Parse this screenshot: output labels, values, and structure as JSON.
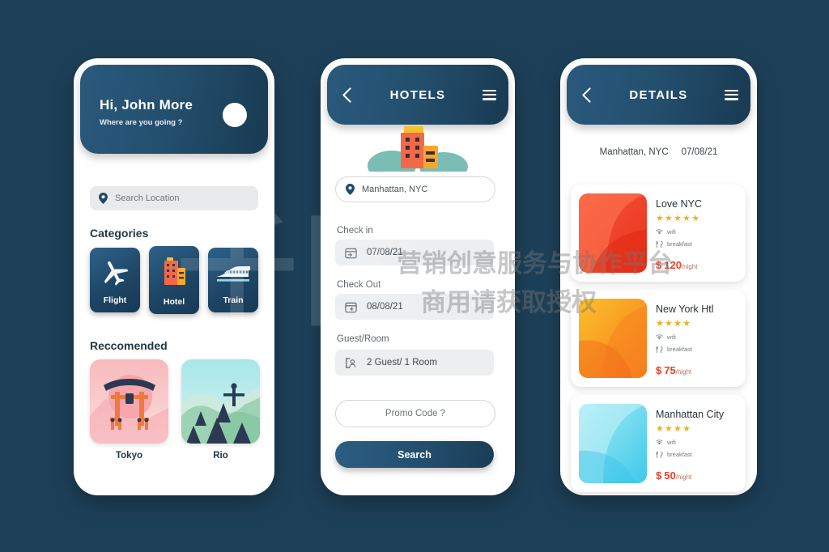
{
  "background_color": "#1d4059",
  "watermark": {
    "logo": "千图",
    "line1": "营销创意服务与协作平台",
    "line2": "商用请获取授权"
  },
  "home_screen": {
    "greeting": "Hi, John More",
    "subgreeting": "Where are you going ?",
    "avatar_icon": "avatar-circle-icon",
    "search": {
      "icon": "location-pin-icon",
      "placeholder": "Search Location"
    },
    "categories_title": "Categories",
    "categories": [
      {
        "label": "Flight",
        "icon": "airplane-icon"
      },
      {
        "label": "Hotel",
        "icon": "hotel-building-icon"
      },
      {
        "label": "Train",
        "icon": "train-icon"
      }
    ],
    "recommended_title": "Reccomended",
    "recommended": [
      {
        "label": "Tokyo",
        "icon": "torii-gate-illustration"
      },
      {
        "label": "Rio",
        "icon": "christ-redeemer-illustration"
      }
    ]
  },
  "hotels_screen": {
    "back_icon": "chevron-left-icon",
    "title": "HOTELS",
    "menu_icon": "hamburger-menu-icon",
    "illustration": "hotel-buildings-illustration",
    "location": {
      "icon": "location-pin-icon",
      "value": "Manhattan, NYC"
    },
    "checkin": {
      "label": "Check in",
      "icon": "calendar-in-icon",
      "value": "07/08/21"
    },
    "checkout": {
      "label": "Check Out",
      "icon": "calendar-out-icon",
      "value": "08/08/21"
    },
    "guest": {
      "label": "Guest/Room",
      "icon": "guest-icon",
      "value": "2 Guest/ 1 Room"
    },
    "promo_label": "Promo Code ?",
    "search_label": "Search"
  },
  "details_screen": {
    "back_icon": "chevron-left-icon",
    "title": "DETAILS",
    "menu_icon": "hamburger-menu-icon",
    "location": "Manhattan, NYC",
    "date": "07/08/21",
    "amenity_labels": {
      "wifi": "wifi",
      "breakfast": "breakfast"
    },
    "currency": "$",
    "per_night": "/night",
    "hotels": [
      {
        "name": "Love NYC",
        "stars": "★★★★★",
        "rating": 5,
        "price": "120",
        "wifi": "wifi",
        "breakfast": "breakfast",
        "thumb": "red-gradient-thumb"
      },
      {
        "name": "New York Htl",
        "stars": "★★★★",
        "rating": 4,
        "price": "75",
        "wifi": "wifi",
        "breakfast": "breakfast",
        "thumb": "orange-gradient-thumb"
      },
      {
        "name": "Manhattan City",
        "stars": "★★★★",
        "rating": 4,
        "price": "50",
        "wifi": "wifi",
        "breakfast": "breakfast",
        "thumb": "cyan-gradient-thumb"
      }
    ]
  }
}
